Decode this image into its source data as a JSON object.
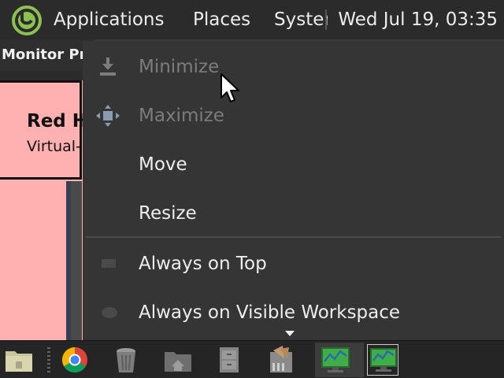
{
  "top_panel": {
    "applications_label": "Applications",
    "places_label": "Places",
    "system_label": "System",
    "clock": "Wed Jul 19, 03:35"
  },
  "background_window": {
    "title": "Monitor Pre",
    "card_title": "Red H",
    "card_subtitle": "Virtual-"
  },
  "window_menu": {
    "items": [
      {
        "label": "Minimize",
        "enabled": false,
        "icon": "minimize-icon"
      },
      {
        "label": "Maximize",
        "enabled": false,
        "icon": "maximize-icon"
      },
      {
        "label": "Move",
        "enabled": true
      },
      {
        "label": "Resize",
        "enabled": true
      },
      {
        "label": "Always on Top",
        "enabled": true,
        "icon": "checkbox-icon"
      },
      {
        "label": "Always on Visible Workspace",
        "enabled": true,
        "icon": "radio-icon"
      }
    ]
  },
  "taskbar": {
    "launchers": [
      "show-desktop-icon",
      "chrome-icon",
      "trash-icon",
      "home-folder-icon",
      "file-cabinet-icon",
      "appearance-icon"
    ],
    "windows": [
      "system-monitor-window-icon",
      "system-monitor-window-icon-active"
    ]
  },
  "colors": {
    "panel_bg": "#2b2b2b",
    "menu_bg": "#353535",
    "disabled_text": "#7c7c7c",
    "background_window": "#ffb0b0",
    "mate_green": "#8cc152"
  }
}
